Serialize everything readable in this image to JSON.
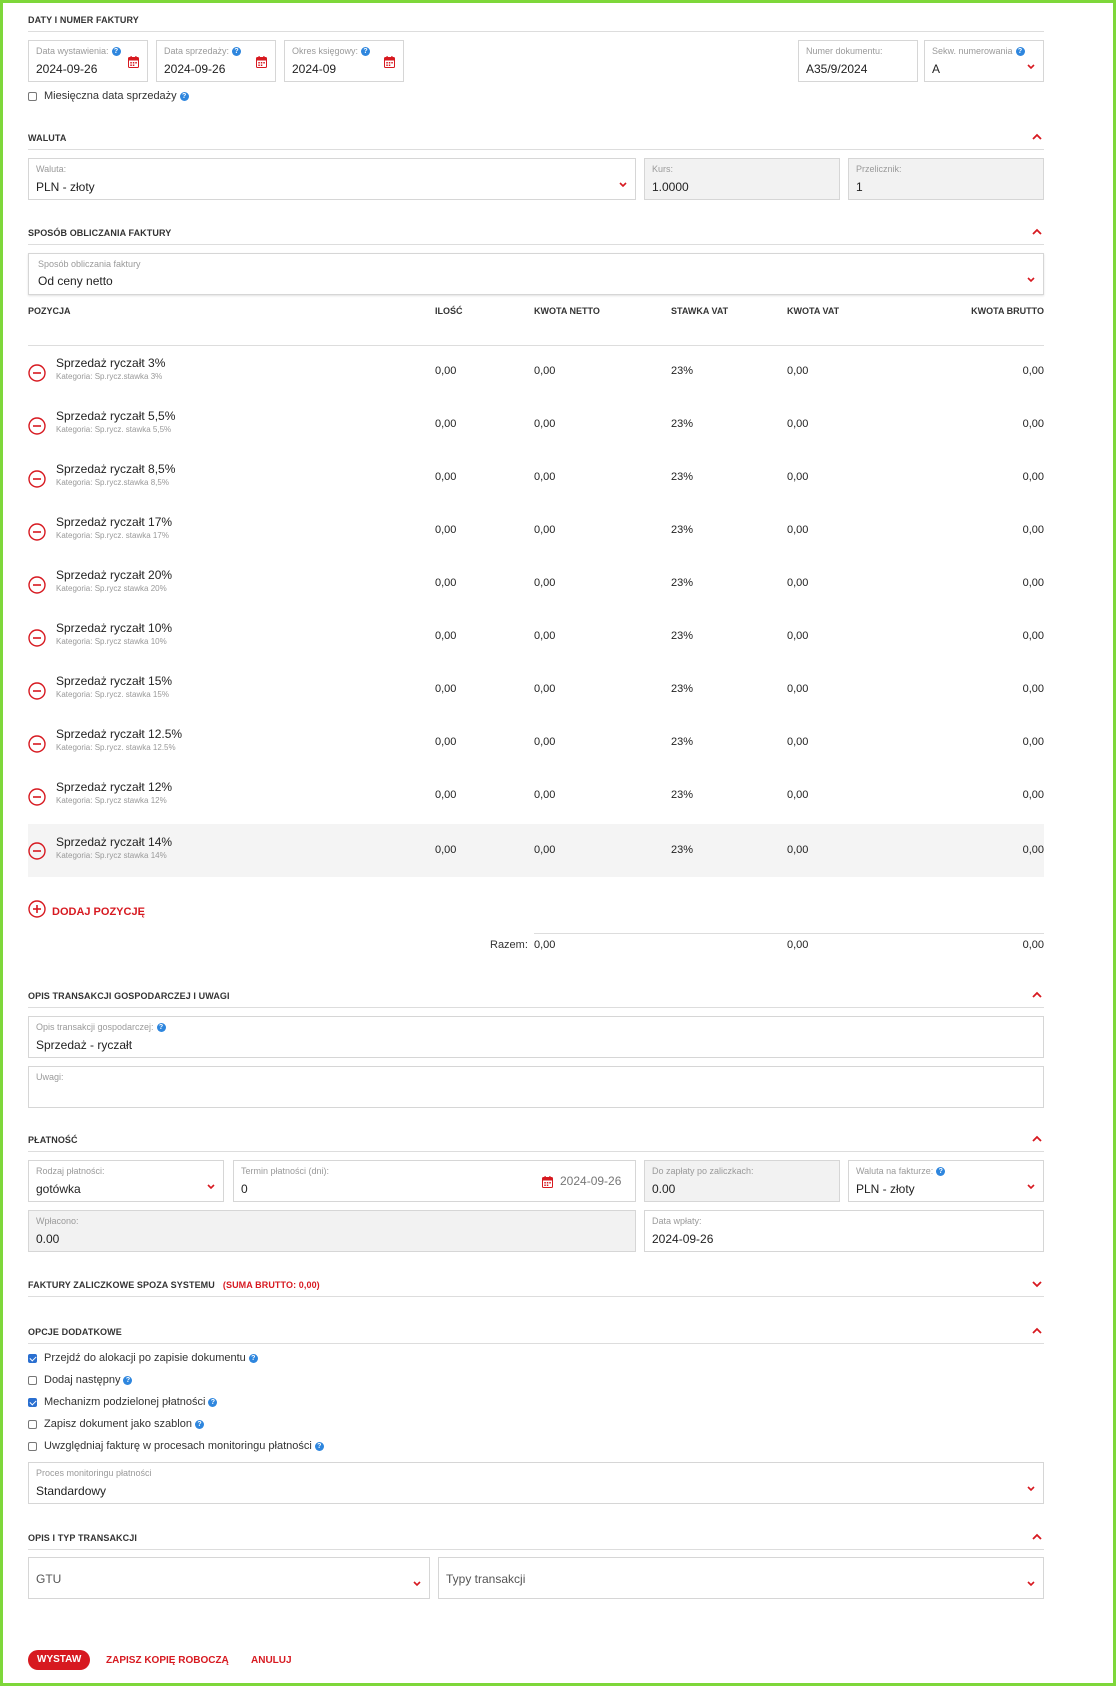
{
  "sections": {
    "dates": {
      "title": "DATY I NUMER FAKTURY",
      "issue_date": {
        "label": "Data wystawienia:",
        "value": "2024-09-26"
      },
      "sale_date": {
        "label": "Data sprzedaży:",
        "value": "2024-09-26"
      },
      "period": {
        "label": "Okres księgowy:",
        "value": "2024-09"
      },
      "doc_number": {
        "label": "Numer dokumentu:",
        "value": "A35/9/2024"
      },
      "sequence": {
        "label": "Sekw. numerowania",
        "value": "A"
      },
      "monthly_checkbox": "Miesięczna data sprzedaży"
    },
    "currency": {
      "title": "WALUTA",
      "currency": {
        "label": "Waluta:",
        "value": "PLN - złoty"
      },
      "rate": {
        "label": "Kurs:",
        "value": "1.0000"
      },
      "multiplier": {
        "label": "Przelicznik:",
        "value": "1"
      }
    },
    "calc": {
      "title": "SPOSÓB OBLICZANIA FAKTURY",
      "method": {
        "label": "Sposób obliczania faktury",
        "value": "Od ceny netto"
      }
    },
    "positions": {
      "headers": {
        "position": "POZYCJA",
        "qty": "ILOŚĆ",
        "net": "KWOTA NETTO",
        "vat_rate": "STAWKA VAT",
        "vat": "KWOTA VAT",
        "gross": "KWOTA BRUTTO"
      },
      "rows": [
        {
          "name": "Sprzedaż ryczałt 3%",
          "category": "Kategoria: Sp.rycz.stawka 3%",
          "qty": "0,00",
          "net": "0,00",
          "rate": "23%",
          "vat": "0,00",
          "gross": "0,00"
        },
        {
          "name": "Sprzedaż ryczałt 5,5%",
          "category": "Kategoria: Sp.rycz. stawka 5,5%",
          "qty": "0,00",
          "net": "0,00",
          "rate": "23%",
          "vat": "0,00",
          "gross": "0,00"
        },
        {
          "name": "Sprzedaż ryczałt 8,5%",
          "category": "Kategoria: Sp.rycz.stawka 8,5%",
          "qty": "0,00",
          "net": "0,00",
          "rate": "23%",
          "vat": "0,00",
          "gross": "0,00"
        },
        {
          "name": "Sprzedaż ryczałt 17%",
          "category": "Kategoria: Sp.rycz. stawka 17%",
          "qty": "0,00",
          "net": "0,00",
          "rate": "23%",
          "vat": "0,00",
          "gross": "0,00"
        },
        {
          "name": "Sprzedaż ryczałt 20%",
          "category": "Kategoria: Sp.rycz stawka 20%",
          "qty": "0,00",
          "net": "0,00",
          "rate": "23%",
          "vat": "0,00",
          "gross": "0,00"
        },
        {
          "name": "Sprzedaż ryczałt 10%",
          "category": "Kategoria: Sp.rycz stawka 10%",
          "qty": "0,00",
          "net": "0,00",
          "rate": "23%",
          "vat": "0,00",
          "gross": "0,00"
        },
        {
          "name": "Sprzedaż ryczałt 15%",
          "category": "Kategoria: Sp.rycz. stawka 15%",
          "qty": "0,00",
          "net": "0,00",
          "rate": "23%",
          "vat": "0,00",
          "gross": "0,00"
        },
        {
          "name": "Sprzedaż ryczałt 12.5%",
          "category": "Kategoria: Sp.rycz. stawka 12.5%",
          "qty": "0,00",
          "net": "0,00",
          "rate": "23%",
          "vat": "0,00",
          "gross": "0,00"
        },
        {
          "name": "Sprzedaż ryczałt 12%",
          "category": "Kategoria: Sp.rycz stawka 12%",
          "qty": "0,00",
          "net": "0,00",
          "rate": "23%",
          "vat": "0,00",
          "gross": "0,00"
        },
        {
          "name": "Sprzedaż ryczałt 14%",
          "category": "Kategoria: Sp.rycz stawka 14%",
          "qty": "0,00",
          "net": "0,00",
          "rate": "23%",
          "vat": "0,00",
          "gross": "0,00"
        }
      ],
      "add_label": "DODAJ POZYCJĘ",
      "totals": {
        "label": "Razem:",
        "net": "0,00",
        "vat": "0,00",
        "gross": "0,00"
      }
    },
    "description": {
      "title": "OPIS TRANSAKCJI GOSPODARCZEJ I UWAGI",
      "desc": {
        "label": "Opis transakcji gospodarczej:",
        "value": "Sprzedaż - ryczałt"
      },
      "notes": {
        "label": "Uwagi:",
        "value": ""
      }
    },
    "payment": {
      "title": "PŁATNOŚĆ",
      "type": {
        "label": "Rodzaj płatności:",
        "value": "gotówka"
      },
      "term": {
        "label": "Termin płatności (dni):",
        "value": "0",
        "date": "2024-09-26"
      },
      "due_after": {
        "label": "Do zapłaty po zaliczkach:",
        "value": "0.00"
      },
      "invoice_currency": {
        "label": "Waluta na fakturze:",
        "value": "PLN - złoty"
      },
      "paid": {
        "label": "Wpłacono:",
        "value": "0.00"
      },
      "paid_date": {
        "label": "Data wpłaty:",
        "value": "2024-09-26"
      }
    },
    "advances": {
      "title": "FAKTURY ZALICZKOWE SPOZA SYSTEMU",
      "sum": "(SUMA BRUTTO: 0,00)"
    },
    "options": {
      "title": "OPCJE DODATKOWE",
      "items": [
        {
          "label": "Przejdź do alokacji po zapisie dokumentu",
          "checked": true
        },
        {
          "label": "Dodaj następny",
          "checked": false
        },
        {
          "label": "Mechanizm podzielonej płatności",
          "checked": true
        },
        {
          "label": "Zapisz dokument jako szablon",
          "checked": false
        },
        {
          "label": "Uwzględniaj fakturę w procesach monitoringu płatności",
          "checked": false
        }
      ],
      "monitoring": {
        "label": "Proces monitoringu płatności",
        "value": "Standardowy"
      }
    },
    "transaction": {
      "title": "OPIS I TYP TRANSAKCJI",
      "gtu": "GTU",
      "types": "Typy transakcji"
    }
  },
  "actions": {
    "issue": "WYSTAW",
    "save_draft": "ZAPISZ KOPIĘ ROBOCZĄ",
    "cancel": "ANULUJ"
  },
  "colors": {
    "accent": "#d71920",
    "help": "#2e86de",
    "frame": "#7ed73a"
  }
}
